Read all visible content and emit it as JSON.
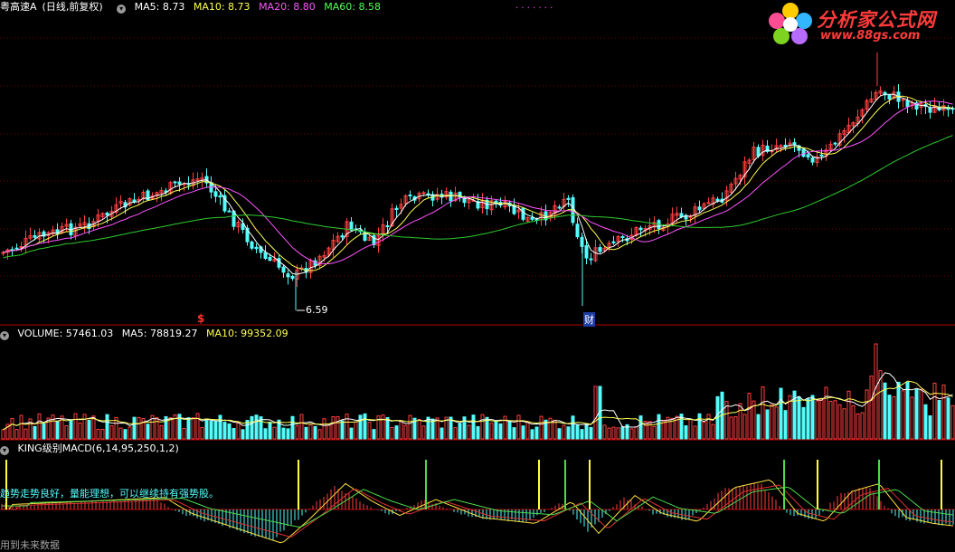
{
  "colors": {
    "up": "#ff4040",
    "down": "#54fcfc",
    "ma5": "#ffffff",
    "ma10": "#ffff54",
    "ma20": "#ff54ff",
    "ma60": "#2ecc2e",
    "divider": "#b00000",
    "grid": "#7a0000",
    "dea": "#e03030",
    "dif": "#ffe040",
    "line3": "#4cd94c"
  },
  "price_panel": {
    "stock": "粤高速A",
    "period": "(日线,前复权)",
    "ma5_label": "MA5: 8.73",
    "ma10_label": "MA10: 8.73",
    "ma20_label": "MA20: 8.80",
    "ma60_label": "MA60: 8.58",
    "low_label": "6.59",
    "dollar_marker": "$",
    "cai_marker": "财",
    "dots": "· · ·   ·        · ·   ·"
  },
  "volume_panel": {
    "volume_label": "VOLUME: 57461.03",
    "ma5_label": "MA5: 78819.27",
    "ma10_label": "MA10: 99352.09"
  },
  "macd_panel": {
    "title": "KING级别MACD(6,14,95,250,1,2)",
    "comment": "趋势走势良好，量能理想，可以继续持有强势股。",
    "footer": "用到未来数据"
  },
  "logo": {
    "text": "分析家公式网",
    "url": "www.88gs.com"
  },
  "chart_data": {
    "type": "candlestick",
    "title": "粤高速A (日线,前复权)",
    "low_marked": 6.59,
    "indicators": {
      "MA5": 8.73,
      "MA10": 8.73,
      "MA20": 8.8,
      "MA60": 8.58
    },
    "volume": {
      "VOLUME": 57461.03,
      "MA5": 78819.27,
      "MA10": 99352.09
    },
    "macd_params": "6,14,95,250,1,2"
  }
}
